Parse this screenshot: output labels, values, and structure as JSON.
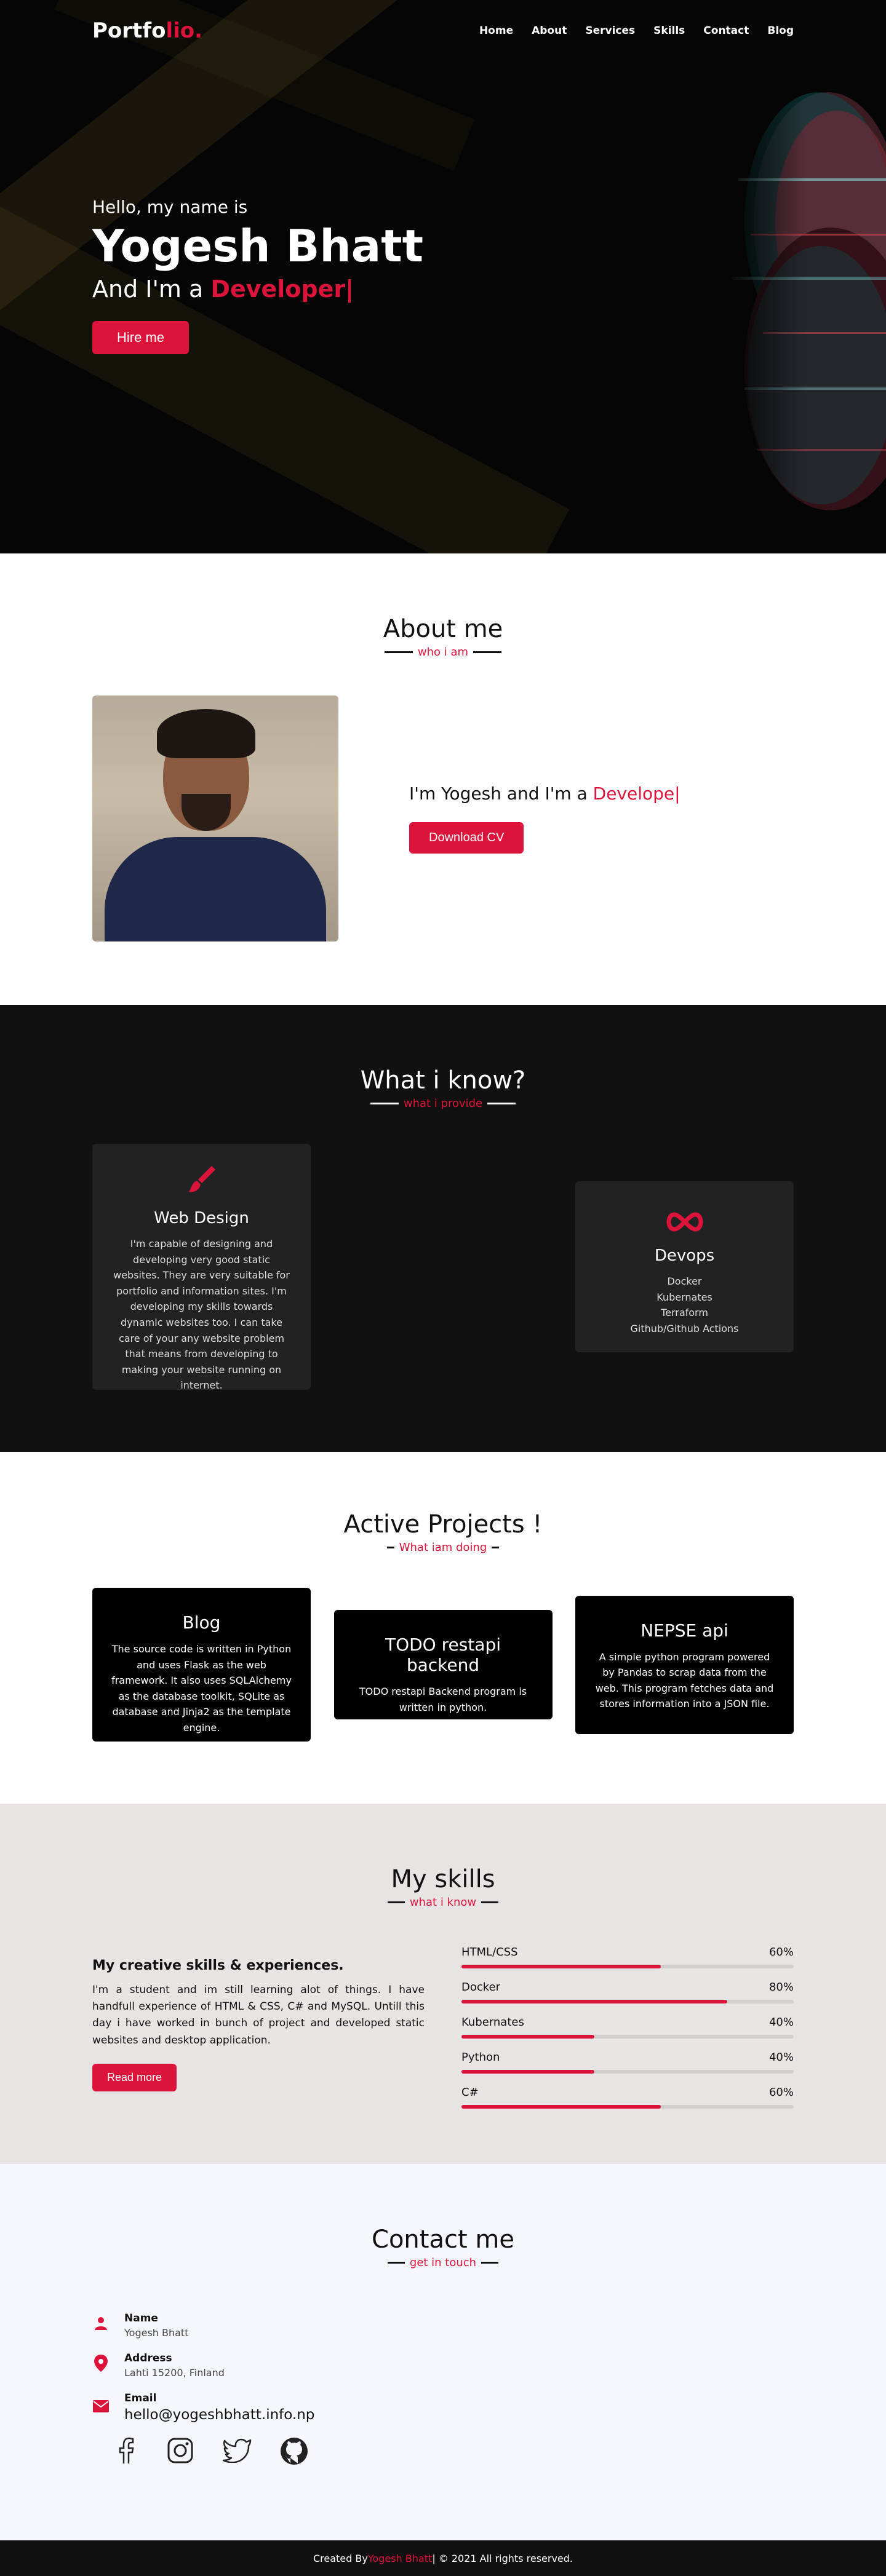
{
  "nav": {
    "logo_main": "Portfo",
    "logo_accent": "lio.",
    "items": [
      "Home",
      "About",
      "Services",
      "Skills",
      "Contact",
      "Blog"
    ]
  },
  "hero": {
    "greeting": "Hello, my name is",
    "name": "Yogesh Bhatt",
    "role_prefix": "And I'm a ",
    "role_highlight": "Developer|",
    "cta": "Hire me"
  },
  "about": {
    "title": "About me",
    "subtitle": "who i am",
    "intro_prefix": "I'm Yogesh and I'm a ",
    "intro_highlight": "Develope|",
    "cta": "Download CV"
  },
  "know": {
    "title": "What i know?",
    "subtitle": "what i provide",
    "cards": [
      {
        "icon": "paint-brush-icon",
        "title": "Web Design",
        "text": "I'm capable of designing and developing very good static websites. They are very suitable for portfolio and information sites. I'm developing my skills towards dynamic websites too. I can take care of your any website problem that means from developing to making your website running on internet."
      },
      {
        "icon": "infinity-icon",
        "title": "Devops",
        "lines": [
          "Docker",
          "Kubernates",
          "Terraform",
          "Github/Github Actions"
        ]
      }
    ]
  },
  "projects": {
    "title": "Active Projects !",
    "subtitle": "What iam doing",
    "cards": [
      {
        "title": "Blog",
        "text": "The source code is written in Python and uses Flask as the web framework. It also uses SQLAlchemy as the database toolkit, SQLite as database and Jinja2 as the template engine."
      },
      {
        "title": "TODO restapi backend",
        "text": "TODO restapi Backend program is written in python."
      },
      {
        "title": "NEPSE api",
        "text": "A simple python program powered by Pandas to scrap data from the web. This program fetches data and stores information into a JSON file."
      }
    ]
  },
  "skills": {
    "title": "My skills",
    "subtitle": "what i know",
    "heading": "My creative skills & experiences.",
    "text": "I'm a student and im still learning alot of things. I have handfull experience of HTML & CSS, C# and MySQL. Untill this day i have worked in bunch of project and developed static websites and desktop application.",
    "cta": "Read more",
    "items": [
      {
        "name": "HTML/CSS",
        "percent_label": "60%",
        "value": 60
      },
      {
        "name": "Docker",
        "percent_label": "80%",
        "value": 80
      },
      {
        "name": "Kubernates",
        "percent_label": "40%",
        "value": 40
      },
      {
        "name": "Python",
        "percent_label": "40%",
        "value": 40
      },
      {
        "name": "C#",
        "percent_label": "60%",
        "value": 60
      }
    ]
  },
  "contact": {
    "title": "Contact me",
    "subtitle": "get in touch",
    "name_label": "Name",
    "name_value": "Yogesh Bhatt",
    "address_label": "Address",
    "address_value": "Lahti 15200, Finland",
    "email_label": "Email",
    "email_value": "hello@yogeshbhatt.info.np",
    "socials": [
      "facebook-icon",
      "instagram-icon",
      "twitter-icon",
      "github-icon"
    ]
  },
  "footer": {
    "prefix": "Created By ",
    "author": "Yogesh Bhatt",
    "suffix": " | © 2021 All rights reserved."
  },
  "colors": {
    "accent": "#dc143c",
    "dark": "#111111",
    "hero_bg": "#050505",
    "skills_bg": "#e9e4e4",
    "contact_bg": "#f6f7fc"
  }
}
